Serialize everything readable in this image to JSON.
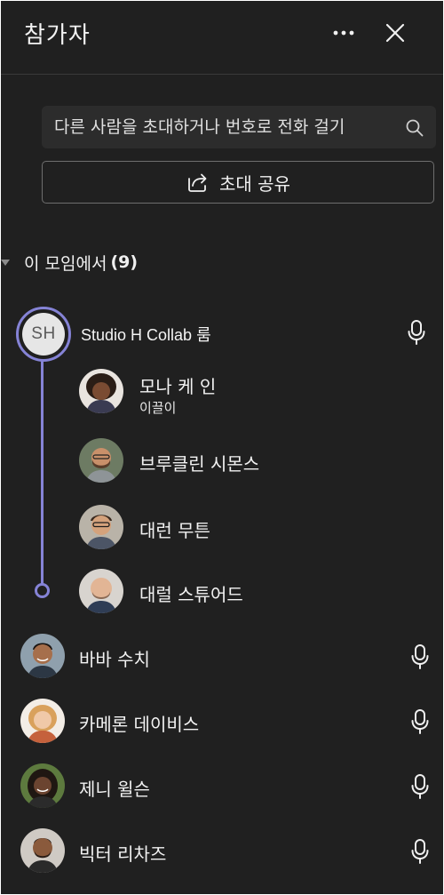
{
  "header": {
    "title": "참가자"
  },
  "search": {
    "placeholder": "다른 사람을 초대하거나 번호로 전화 걸기"
  },
  "share_button": {
    "label": "초대 공유"
  },
  "section": {
    "title": "이 모임에서",
    "count": "(9)"
  },
  "room": {
    "initials": "SH",
    "name": "Studio H Collab 룸"
  },
  "room_members": [
    {
      "name": "모나 케 인",
      "role": "이끌이",
      "avatar": "woman-curly-hair"
    },
    {
      "name": "브루클린 시몬스",
      "avatar": "man-beard-glasses"
    },
    {
      "name": "대런 무튼",
      "avatar": "man-glasses"
    },
    {
      "name": "대럴 스튜어드",
      "avatar": "bald-man-smiling"
    }
  ],
  "participants": [
    {
      "name": "바바 수치",
      "avatar": "man-smiling"
    },
    {
      "name": "카메론 데이비스",
      "avatar": "woman-blonde"
    },
    {
      "name": "제니 윌슨",
      "avatar": "woman-braids"
    },
    {
      "name": "빅터 리차즈",
      "avatar": "man-dark-shirt"
    }
  ],
  "colors": {
    "accent": "#8583d6",
    "panel_bg": "#202020",
    "search_bg": "#2c2c2c"
  }
}
